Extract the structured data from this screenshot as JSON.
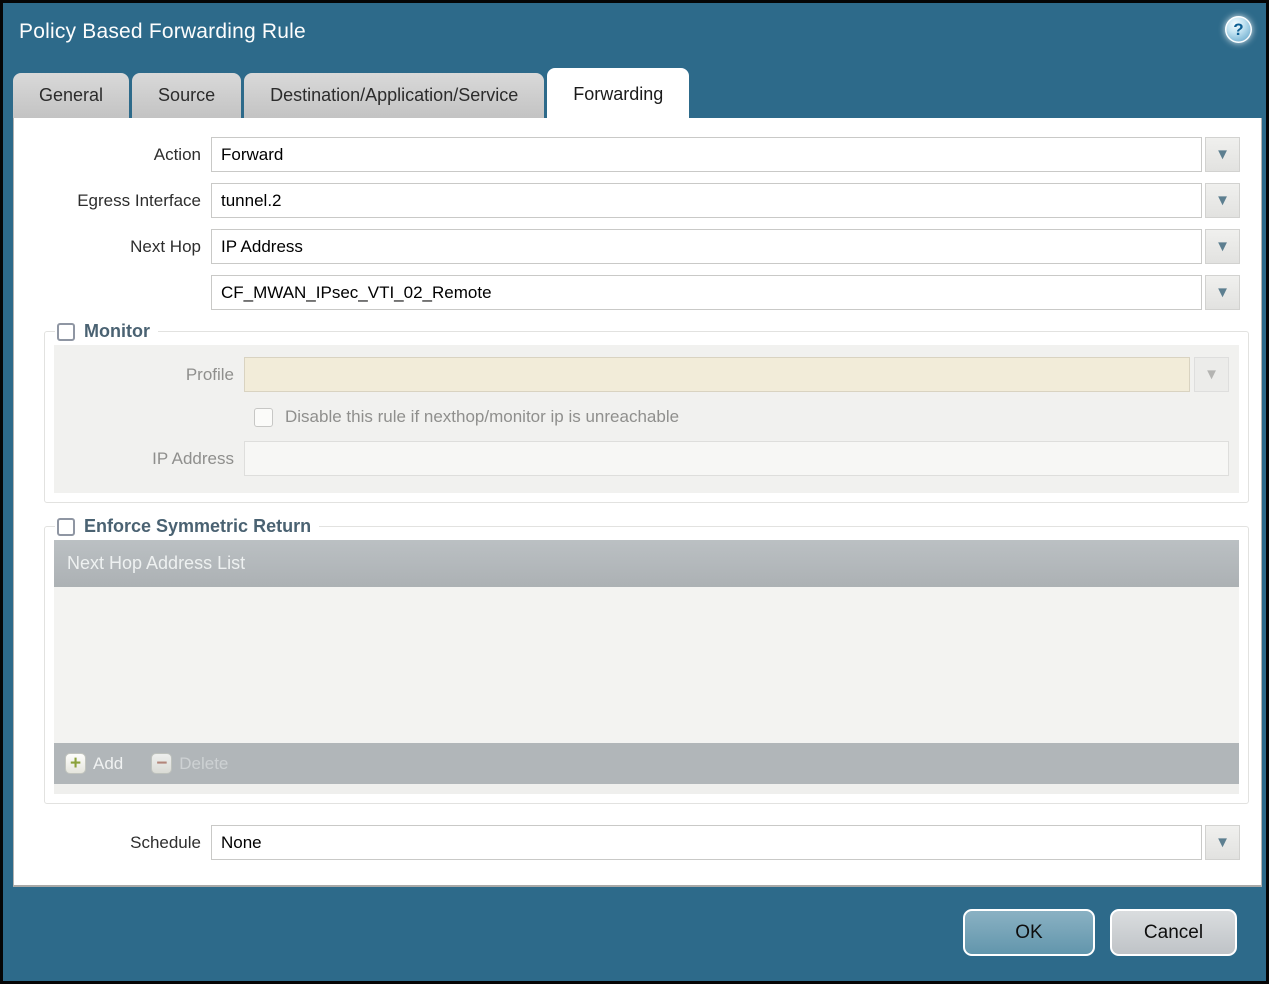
{
  "window": {
    "title": "Policy Based Forwarding Rule"
  },
  "icons": {
    "help": "?",
    "chevron_down": "▼",
    "add": "+",
    "delete": "−"
  },
  "tabs": [
    {
      "label": "General",
      "active": false
    },
    {
      "label": "Source",
      "active": false
    },
    {
      "label": "Destination/Application/Service",
      "active": false
    },
    {
      "label": "Forwarding",
      "active": true
    }
  ],
  "form": {
    "action": {
      "label": "Action",
      "value": "Forward"
    },
    "egress_interface": {
      "label": "Egress Interface",
      "value": "tunnel.2"
    },
    "next_hop": {
      "label": "Next Hop",
      "value": "IP Address"
    },
    "next_hop_address": {
      "value": "CF_MWAN_IPsec_VTI_02_Remote"
    },
    "schedule": {
      "label": "Schedule",
      "value": "None"
    }
  },
  "monitor": {
    "title": "Monitor",
    "checked": false,
    "profile": {
      "label": "Profile",
      "value": ""
    },
    "disable_rule": {
      "label": "Disable this rule if nexthop/monitor ip is unreachable",
      "checked": false
    },
    "ip_address": {
      "label": "IP Address",
      "value": ""
    }
  },
  "symmetric_return": {
    "title": "Enforce Symmetric Return",
    "checked": false,
    "table": {
      "header": "Next Hop Address List",
      "rows": []
    },
    "add_label": "Add",
    "delete_label": "Delete"
  },
  "footer": {
    "ok": "OK",
    "cancel": "Cancel"
  },
  "colors": {
    "titlebar_teal": "#2d6a8a",
    "dropdown_arrow_blue": "#5d7f90",
    "disabled_field_beige": "#f2ecd9",
    "table_header_gray": "#b1b6b9",
    "section_title_slate": "#4a6272",
    "ok_button_blue": "#74a3b8",
    "cancel_button_gray": "#cdd1d5"
  }
}
